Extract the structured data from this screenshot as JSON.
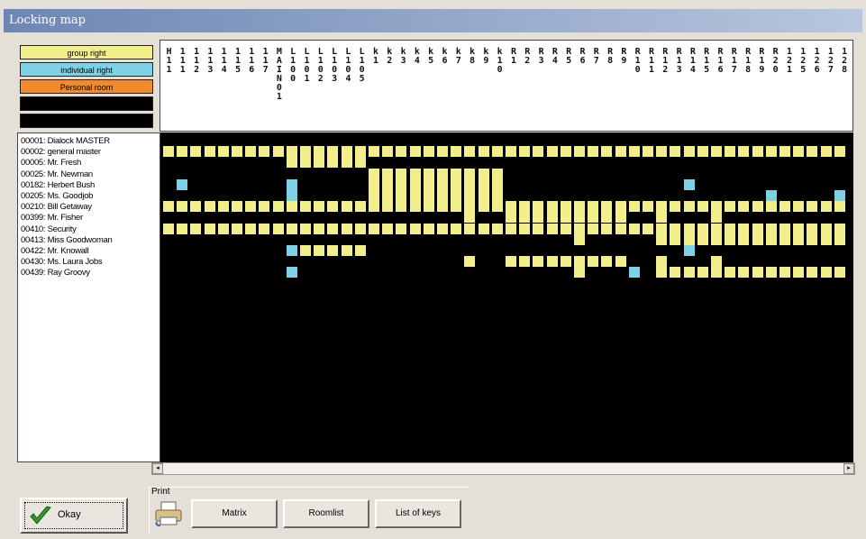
{
  "window": {
    "title": "Locking map"
  },
  "legend": [
    {
      "label": "group right",
      "color": "#f3ee8c"
    },
    {
      "label": "individual right",
      "color": "#7fd2e6"
    },
    {
      "label": "Personal room",
      "color": "#f08a2c"
    },
    {
      "label": "",
      "color": "#000000"
    },
    {
      "label": "",
      "color": "#000000"
    }
  ],
  "columns": [
    "H11",
    "111",
    "112",
    "113",
    "114",
    "115",
    "116",
    "117",
    "MAIN01",
    "L100",
    "L101",
    "L102",
    "L103",
    "L104",
    "L105",
    "k1",
    "k2",
    "k3",
    "k4",
    "k5",
    "k6",
    "k7",
    "k8",
    "k9",
    "k10",
    "R1",
    "R2",
    "R3",
    "R4",
    "R5",
    "R6",
    "R7",
    "R8",
    "R9",
    "R10",
    "R11",
    "R12",
    "R13",
    "R14",
    "R15",
    "R16",
    "R17",
    "R18",
    "R19",
    "R20",
    "121",
    "125",
    "126",
    "127",
    "128"
  ],
  "keys": [
    "00001: Dialock MASTER",
    "00002: general master",
    "00005: Mr. Fresh",
    "00025: Mr. Newman",
    "00182: Herbert Bush",
    "00205: Ms. Goodjob",
    "00210: Bill Getaway",
    "00399: Mr. Fisher",
    "00410: Security",
    "00413: Miss Goodwoman",
    "00422: Mr. Knowall",
    "00430: Ms. Laura Jobs",
    "00439: Ray Groovy"
  ],
  "matrix": [
    "",
    "yyyyyyyyyyyyyyyyyyyyyyyyyyyyyyyyyyyyyyyyyyyyyyyyyy",
    "_________yyyyyy___________________________________",
    "_______________yyyyyyyyyy_________________________",
    "_b_______b_____yyyyyyyyyy_____________b___________",
    "_________b_____yyyyyyyyyy___________________b____b",
    "yyyyyyyyyyyyyyyyyyyyyyyyyyyyyyyyyyyyyyyyyyyyyyyyyy",
    "______________________y__yyyyyyyyy__y___y_________",
    "yyyyyyyyyyyyyyyyyyyyyyyyyyyyyyyyyyyyyyyyyyyyyyyyyy",
    "______________________________y_____yyyyyyyyyyyyyy",
    "_________byyyyy_______________________b___________",
    "______________________y__yyyyyyyyy__y___y_________",
    "_________b____________________y___b_yyyyyyyyyyyyyy"
  ],
  "hscroll": {
    "left": "◂",
    "right": "▸"
  },
  "buttons": {
    "ok": "Okay",
    "print_group": "Print",
    "matrix": "Matrix",
    "roomlist": "Roomlist",
    "list_of_keys": "List of keys"
  },
  "colors": {
    "group_right": "#f3ee8c",
    "individual_right": "#7fd2e6",
    "personal_room": "#f08a2c"
  }
}
